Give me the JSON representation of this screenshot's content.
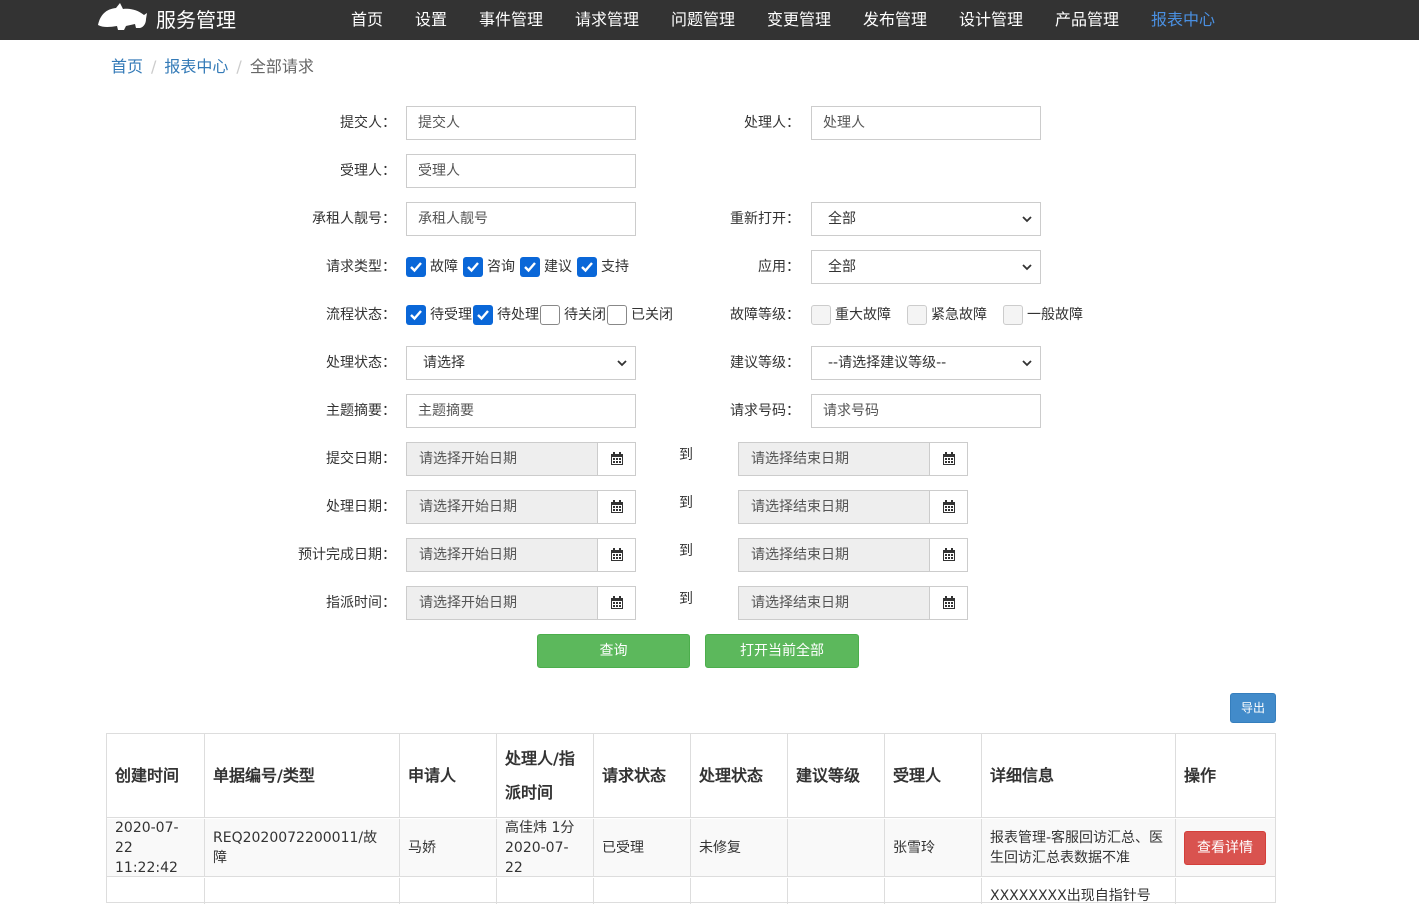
{
  "app": {
    "logo_text": "服务管理"
  },
  "nav": {
    "items": [
      {
        "label": "首页"
      },
      {
        "label": "设置"
      },
      {
        "label": "事件管理"
      },
      {
        "label": "请求管理"
      },
      {
        "label": "问题管理"
      },
      {
        "label": "变更管理"
      },
      {
        "label": "发布管理"
      },
      {
        "label": "设计管理"
      },
      {
        "label": "产品管理"
      },
      {
        "label": "报表中心",
        "active": true
      }
    ]
  },
  "breadcrumb": {
    "home": "首页",
    "section": "报表中心",
    "current": "全部请求"
  },
  "form": {
    "submitter": {
      "label": "提交人：",
      "placeholder": "提交人"
    },
    "handler": {
      "label": "处理人：",
      "placeholder": "处理人"
    },
    "acceptor": {
      "label": "受理人：",
      "placeholder": "受理人"
    },
    "tenant": {
      "label": "承租人靓号：",
      "placeholder": "承租人靓号"
    },
    "reopen": {
      "label": "重新打开：",
      "value": "全部"
    },
    "request_type": {
      "label": "请求类型：",
      "options": [
        {
          "label": "故障",
          "checked": true
        },
        {
          "label": "咨询",
          "checked": true
        },
        {
          "label": "建议",
          "checked": true
        },
        {
          "label": "支持",
          "checked": true
        }
      ]
    },
    "application": {
      "label": "应用：",
      "value": "全部"
    },
    "flow_status": {
      "label": "流程状态：",
      "options": [
        {
          "label": "待受理",
          "checked": true
        },
        {
          "label": "待处理",
          "checked": true
        },
        {
          "label": "待关闭",
          "checked": false
        },
        {
          "label": "已关闭",
          "checked": false
        }
      ]
    },
    "fault_level": {
      "label": "故障等级：",
      "options": [
        {
          "label": "重大故障",
          "checked": false
        },
        {
          "label": "紧急故障",
          "checked": false
        },
        {
          "label": "一般故障",
          "checked": false
        }
      ]
    },
    "process_status": {
      "label": "处理状态：",
      "value": "请选择"
    },
    "suggestion_level": {
      "label": "建议等级：",
      "value": "--请选择建议等级--"
    },
    "subject": {
      "label": "主题摘要：",
      "placeholder": "主题摘要"
    },
    "request_no": {
      "label": "请求号码：",
      "placeholder": "请求号码"
    },
    "date_to": "到",
    "start_placeholder": "请选择开始日期",
    "end_placeholder": "请选择结束日期",
    "submit_date": {
      "label": "提交日期："
    },
    "process_date": {
      "label": "处理日期："
    },
    "expected_date": {
      "label": "预计完成日期："
    },
    "assign_time": {
      "label": "指派时间："
    },
    "query_button": "查询",
    "open_all_button": "打开当前全部",
    "export_button": "导出"
  },
  "table": {
    "headers": [
      "创建时间",
      "单据编号/类型",
      "申请人",
      "处理人/指派时间",
      "请求状态",
      "处理状态",
      "建议等级",
      "受理人",
      "详细信息",
      "操作"
    ],
    "rows": [
      {
        "created_date": "2020-07-22",
        "created_time": "11:22:42",
        "number_type": "REQ2020072200011/故障",
        "applicant": "马娇",
        "handler_line1": "高佳炜 1分",
        "handler_line2": "2020-07-22",
        "request_status": "已受理",
        "process_status": "未修复",
        "suggestion_level": "",
        "acceptor": "张雪玲",
        "detail": "报表管理-客服回访汇总、医生回访汇总表数据不准",
        "action": "查看详情"
      },
      {
        "detail": "XXXXXXXX出现自指针号"
      }
    ]
  },
  "colors": {
    "topbar": "#333333",
    "accent": "#4a90e2",
    "green": "#5cb85c",
    "blue": "#428bca",
    "red": "#d9534f",
    "checkbox": "#0a67d8"
  }
}
